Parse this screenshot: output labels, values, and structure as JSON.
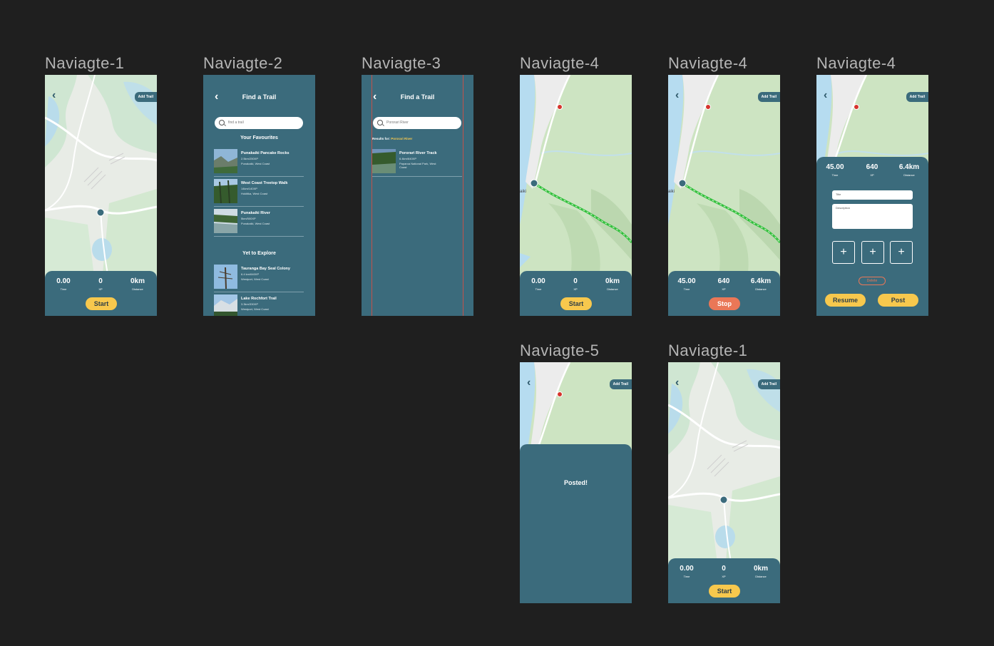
{
  "frames": {
    "f1": {
      "label": "Naviagte-1",
      "start": "Start",
      "time": "0.00",
      "time_label": "Time",
      "xp": "0",
      "xp_label": "XP",
      "dist": "0km",
      "dist_label": "Distance",
      "add_trail": "Add Trail"
    },
    "f2": {
      "label": "Naviagte-2",
      "title": "Find a Trail",
      "search_placeholder": "find a trail",
      "favourites": "Your Favourites",
      "explore": "Yet to Explore",
      "items": [
        {
          "name": "Punakaiki Pancake Rocks",
          "stats": "2.5km/250XP",
          "loc": "Punakaiki, West Coast"
        },
        {
          "name": "West Coast Treetop Walk",
          "stats": "14km/140XP",
          "loc": "Hokitika, West Coast"
        },
        {
          "name": "Punakaiki River",
          "stats": "5km/500XP",
          "loc": "Punakaiki, West Coast"
        },
        {
          "name": "Tauranga Bay Seal Colony",
          "stats": "6.4 km/640XP",
          "loc": "Westport, West Coast"
        },
        {
          "name": "Lake Rochfort Trail",
          "stats": "3.3km/330XP",
          "loc": "Westport, West Coast"
        }
      ]
    },
    "f3": {
      "label": "Naviagte-3",
      "title": "Find a Trail",
      "search_value": "Pororari River",
      "results_prefix": "Results for: ",
      "results_term": "Pororari River",
      "result": {
        "name": "Pororari River Track",
        "stats": "6.4km/640XP",
        "loc": "Paparoa National Park, West Coast"
      }
    },
    "f4a": {
      "label": "Naviagte-4",
      "time": "0.00",
      "time_label": "Time",
      "xp": "0",
      "xp_label": "XP",
      "dist": "0km",
      "dist_label": "Distance",
      "button": "Start",
      "place": "aiki"
    },
    "f4b": {
      "label": "Naviagte-4",
      "time": "45.00",
      "time_label": "Time",
      "xp": "640",
      "xp_label": "XP",
      "dist": "6.4km",
      "dist_label": "Distance",
      "button": "Stop",
      "add_trail": "Add Trail",
      "place": "aiki"
    },
    "f4c": {
      "label": "Naviagte-4",
      "time": "45.00",
      "time_label": "Time",
      "xp": "640",
      "xp_label": "XP",
      "dist": "6.4km",
      "dist_label": "Distance",
      "title_ph": "Title",
      "desc_ph": "Description",
      "delete": "Delete",
      "resume": "Resume",
      "post": "Post",
      "add_trail": "Add Trail"
    },
    "f5": {
      "label": "Naviagte-5",
      "message": "Posted!",
      "add_trail": "Add Trail"
    },
    "f6": {
      "label": "Naviagte-1",
      "start": "Start",
      "time": "0.00",
      "time_label": "Time",
      "xp": "0",
      "xp_label": "XP",
      "dist": "0km",
      "dist_label": "Distance",
      "add_trail": "Add Trail"
    }
  },
  "colors": {
    "canvas": "#1f1f1f",
    "panel": "#3b6b7c",
    "accent_yellow": "#f7c84d",
    "stop_red": "#ea7757",
    "trail_green": "#2fbf3a"
  }
}
